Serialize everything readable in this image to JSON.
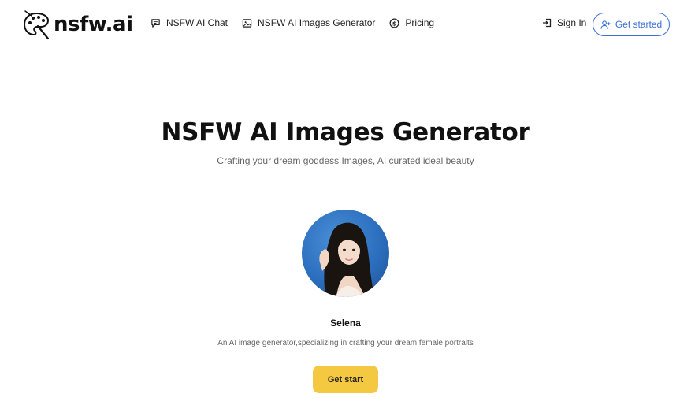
{
  "brand": {
    "name": "nsfw.ai",
    "logo_icon": "palette-icon"
  },
  "nav": {
    "items": [
      {
        "label": "NSFW AI Chat",
        "icon": "chat-bubble-icon"
      },
      {
        "label": "NSFW AI Images Generator",
        "icon": "image-icon"
      },
      {
        "label": "Pricing",
        "icon": "dollar-circle-icon"
      }
    ]
  },
  "auth": {
    "sign_in": "Sign In",
    "sign_in_icon": "login-icon",
    "get_started": "Get started",
    "get_started_icon": "user-plus-icon",
    "accent_color": "#3b6fd4"
  },
  "hero": {
    "title": "NSFW AI Images Generator",
    "subtitle": "Crafting your dream goddess Images, AI curated ideal beauty"
  },
  "character": {
    "name": "Selena",
    "description": "An AI image generator,specializing in crafting your dream female portraits",
    "cta": "Get start",
    "cta_color": "#f5c842"
  }
}
